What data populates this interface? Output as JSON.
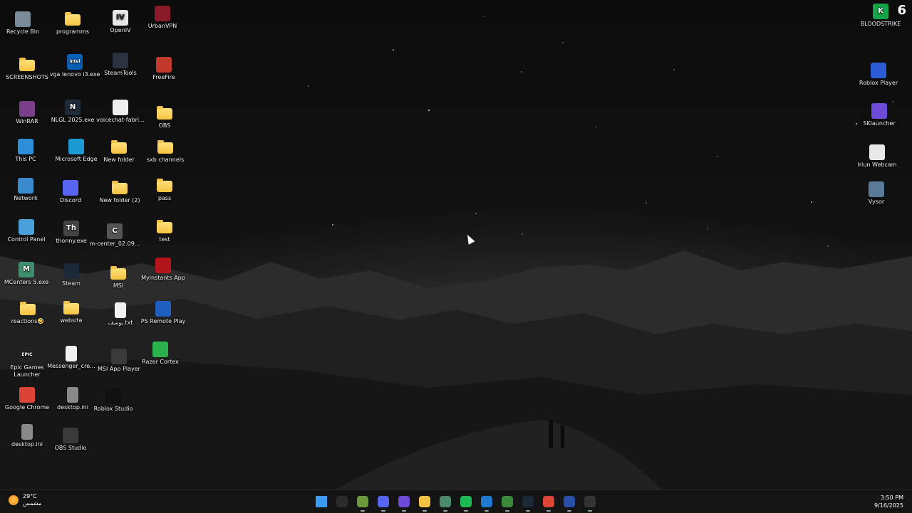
{
  "desktop": {
    "icons": [
      {
        "label": "Recycle Bin",
        "icon": "recycle-bin-icon"
      },
      {
        "label": "programms",
        "icon": "folder-icon"
      },
      {
        "label": "OpenIV",
        "icon": "openiv-icon",
        "glyph": "IV"
      },
      {
        "label": "UrbanVPN",
        "icon": "urbanvpn-icon"
      },
      {
        "label": "SCREENSHOTS",
        "icon": "folder-icon"
      },
      {
        "label": "vga lenovo i3.exe",
        "icon": "intel-icon",
        "glyph": "intel"
      },
      {
        "label": "SteamTools",
        "icon": "steamtools-icon"
      },
      {
        "label": "FreeFire",
        "icon": "freefire-icon"
      },
      {
        "label": "WinRAR",
        "icon": "winrar-icon"
      },
      {
        "label": "NLGL 2025.exe",
        "icon": "nlgl-icon",
        "glyph": "N"
      },
      {
        "label": "voicechat-fabri...",
        "icon": "java-icon"
      },
      {
        "label": "OBS",
        "icon": "folder-icon"
      },
      {
        "label": "This PC",
        "icon": "this-pc-icon"
      },
      {
        "label": "Microsoft Edge",
        "icon": "edge-icon"
      },
      {
        "label": "New folder",
        "icon": "folder-icon"
      },
      {
        "label": "sxb channels",
        "icon": "folder-icon"
      },
      {
        "label": "Network",
        "icon": "network-icon"
      },
      {
        "label": "Discord",
        "icon": "discord-icon"
      },
      {
        "label": "New folder (2)",
        "icon": "folder-icon"
      },
      {
        "label": "pass",
        "icon": "folder-icon"
      },
      {
        "label": "Control Panel",
        "icon": "control-panel-icon"
      },
      {
        "label": "thonny.exe",
        "icon": "thonny-icon",
        "glyph": "Th"
      },
      {
        "label": "m-center_02.09...",
        "icon": "mcenter-icon",
        "glyph": "C"
      },
      {
        "label": "test",
        "icon": "folder-icon"
      },
      {
        "label": "MCenters 5.exe",
        "icon": "mcenters-icon",
        "glyph": "M"
      },
      {
        "label": "Steam",
        "icon": "steam-icon"
      },
      {
        "label": "MSI",
        "icon": "folder-icon"
      },
      {
        "label": "Myinstants App",
        "icon": "myinstants-icon"
      },
      {
        "label": "reactions🤣",
        "icon": "folder-icon"
      },
      {
        "label": "website",
        "icon": "folder-icon"
      },
      {
        "label": "يوسف.txt",
        "icon": "text-file-icon"
      },
      {
        "label": "PS Remote Play",
        "icon": "ps-remote-play-icon"
      },
      {
        "label": "Epic Games Launcher",
        "icon": "epic-games-icon",
        "glyph": "EPIC"
      },
      {
        "label": "Messenger_cre...",
        "icon": "chrome-file-icon"
      },
      {
        "label": "MSI App Player",
        "icon": "msi-app-player-icon"
      },
      {
        "label": "Razer Cortex",
        "icon": "razer-cortex-icon"
      },
      {
        "label": "Google Chrome",
        "icon": "chrome-icon"
      },
      {
        "label": "desktop.ini",
        "icon": "settings-file-icon"
      },
      {
        "label": "Roblox Studio",
        "icon": "roblox-studio-icon"
      },
      {
        "label": "desktop.ini",
        "icon": "settings-file-icon"
      },
      {
        "label": "OBS Studio",
        "icon": "obs-icon"
      },
      {
        "label": "BLOODSTRIKE",
        "icon": "bloodstrike-icon",
        "glyph": "K"
      },
      {
        "label": "Roblox Player",
        "icon": "roblox-player-icon"
      },
      {
        "label": "SKlauncher",
        "icon": "sklauncher-icon"
      },
      {
        "label": "Iriun Webcam",
        "icon": "iriun-webcam-icon"
      },
      {
        "label": "Vysor",
        "icon": "vysor-icon"
      }
    ],
    "corner_badge": "6"
  },
  "taskbar": {
    "weather": {
      "temp": "29°C",
      "condition": "مشمس",
      "icon": "sun-icon"
    },
    "apps": [
      {
        "name": "start-button",
        "icon": "windows-icon",
        "color": "#3a9bf0"
      },
      {
        "name": "taskbar-app-terminal",
        "icon": "terminal-icon",
        "color": "#2b2b2b"
      },
      {
        "name": "taskbar-app-minecraft",
        "icon": "minecraft-icon",
        "color": "#6a9a3a"
      },
      {
        "name": "taskbar-app-discord",
        "icon": "discord-icon",
        "color": "#5865f2"
      },
      {
        "name": "taskbar-app-sklauncher",
        "icon": "sklauncher-icon",
        "color": "#6b4bd8"
      },
      {
        "name": "taskbar-app-file-explorer",
        "icon": "folder-icon",
        "color": "#f4c242"
      },
      {
        "name": "taskbar-app-mcenters",
        "icon": "mcenters-icon",
        "color": "#4a8a6a"
      },
      {
        "name": "taskbar-app-spotify",
        "icon": "spotify-icon",
        "color": "#1db954"
      },
      {
        "name": "taskbar-app-vscode",
        "icon": "vscode-icon",
        "color": "#1e7ad0"
      },
      {
        "name": "taskbar-app-chrome-alt",
        "icon": "chrome-icon",
        "color": "#3a8a3a"
      },
      {
        "name": "taskbar-app-steam",
        "icon": "steam-icon",
        "color": "#1b2838"
      },
      {
        "name": "taskbar-app-chrome",
        "icon": "chrome-icon",
        "color": "#db4437"
      },
      {
        "name": "taskbar-app-info",
        "icon": "info-icon",
        "color": "#2a4fa8"
      },
      {
        "name": "taskbar-app-obs",
        "icon": "obs-icon",
        "color": "#333333"
      }
    ],
    "clock": {
      "time": "3:50 PM",
      "date": "9/16/2025"
    }
  }
}
